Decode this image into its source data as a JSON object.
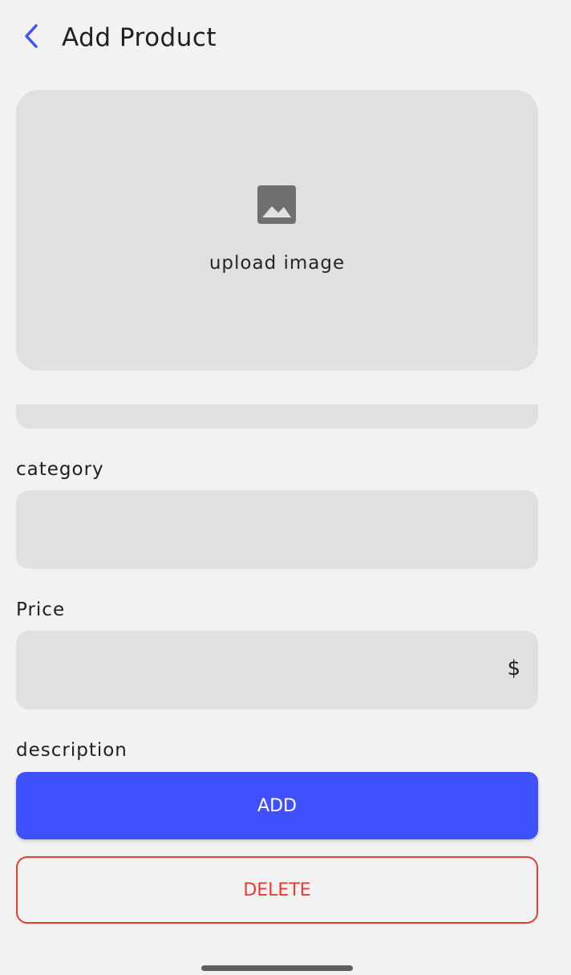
{
  "header": {
    "back_icon": "chevron-left-icon",
    "title": "Add Product"
  },
  "upload": {
    "icon": "image-icon",
    "label": "upload image"
  },
  "fields": {
    "category_label": "category",
    "price_label": "Price",
    "price_currency": "$",
    "description_label": "description"
  },
  "actions": {
    "add_label": "ADD",
    "delete_label": "DELETE"
  },
  "colors": {
    "accent": "#3f51ff",
    "danger": "#ea3b30",
    "field_bg": "#e0e0e0",
    "page_bg": "#f2f2f2"
  }
}
